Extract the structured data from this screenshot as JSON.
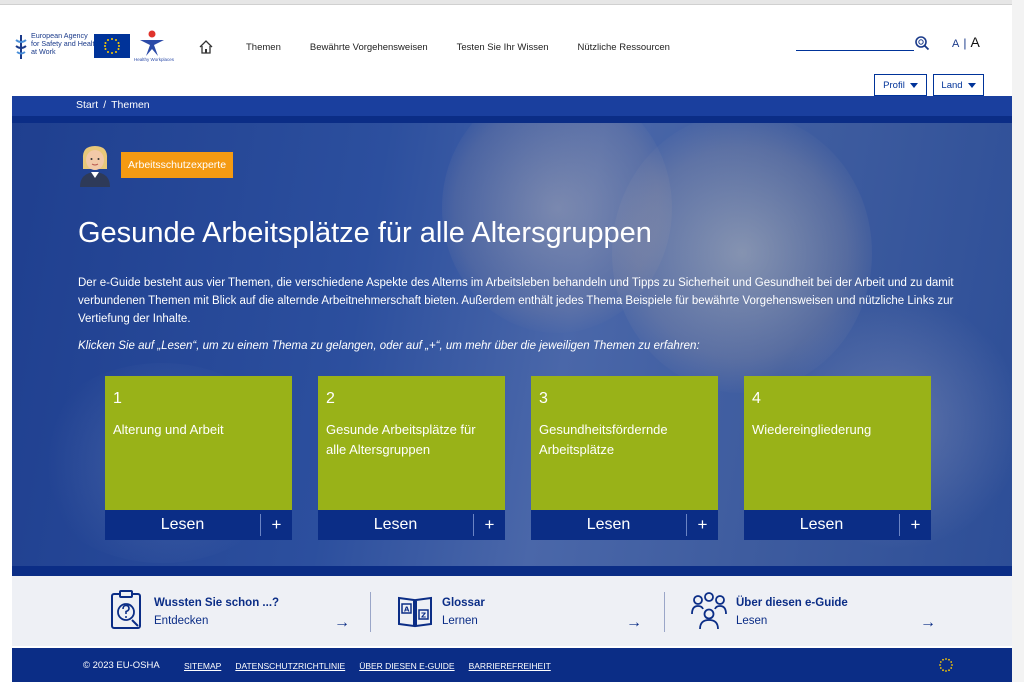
{
  "header": {
    "logo_osha_text": [
      "European Agency",
      "for Safety and Health",
      "at Work"
    ],
    "logo_hw_text": "Healthy Workplaces",
    "nav": [
      "Themen",
      "Bewährte Vorgehensweisen",
      "Testen Sie Ihr Wissen",
      "Nützliche Ressourcen"
    ],
    "search_placeholder": "",
    "font_small": "A",
    "font_sep": "|",
    "font_big": "A",
    "profile_label": "Profil",
    "country_label": "Land"
  },
  "breadcrumb": {
    "items": [
      "Start",
      "Themen"
    ],
    "separator": "/"
  },
  "hero": {
    "badge": "Arbeitsschutzexperte",
    "title": "Gesunde Arbeitsplätze für alle Altersgruppen",
    "intro": "Der e-Guide besteht aus vier Themen, die verschiedene Aspekte des Alterns im Arbeitsleben behandeln und Tipps zu Sicherheit und Gesundheit bei der Arbeit und zu damit verbundenen Themen mit Blick auf  die alternde Arbeitnehmerschaft bieten. Außerdem enthält jedes Thema Beispiele für bewährte Vorgehensweisen und nützliche Links zur Vertiefung der Inhalte.",
    "hint": "Klicken Sie auf „Lesen“, um zu einem Thema zu gelangen, oder auf „+“, um mehr über die jeweiligen Themen zu erfahren:",
    "cards": [
      {
        "number": "1",
        "title": "Alterung und Arbeit",
        "read": "Lesen",
        "plus": "+"
      },
      {
        "number": "2",
        "title": "Gesunde Arbeitsplätze für alle Altersgruppen",
        "read": "Lesen",
        "plus": "+"
      },
      {
        "number": "3",
        "title": "Gesundheitsfördernde Arbeitsplätze",
        "read": "Lesen",
        "plus": "+"
      },
      {
        "number": "4",
        "title": "Wiedereingliederung",
        "read": "Lesen",
        "plus": "+"
      }
    ],
    "colors": {
      "card": "#99b218",
      "bar": "#0b2d86",
      "badge": "#f49a12"
    }
  },
  "info": [
    {
      "title": "Wussten Sie schon ...?",
      "sub": "Entdecken",
      "arrow": "→",
      "icon": "clipboard-question-icon"
    },
    {
      "title": "Glossar",
      "sub": "Lernen",
      "arrow": "→",
      "icon": "glossary-book-icon"
    },
    {
      "title": "Über diesen e-Guide",
      "sub": "Lesen",
      "arrow": "→",
      "icon": "people-group-icon"
    }
  ],
  "footer": {
    "copyright": "© 2023 EU-OSHA",
    "links": [
      "SITEMAP",
      "DATENSCHUTZRICHTLINIE",
      "ÜBER DIESEN E-GUIDE",
      "BARRIEREFREIHEIT"
    ]
  }
}
